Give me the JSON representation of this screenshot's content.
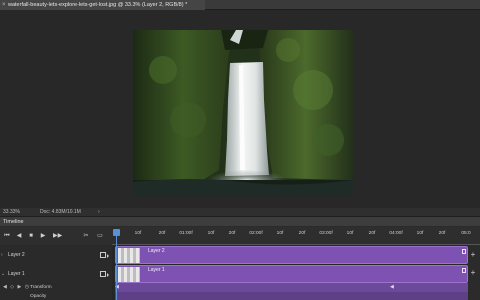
{
  "document": {
    "tab_title": "waterfall-beauty-lets-explore-lets-get-lost.jpg @ 33.3% (Layer 2, RGB/8) *",
    "close_glyph": "×"
  },
  "status": {
    "zoom": "33.33%",
    "doc_size": "Doc: 4.83M/10.1M",
    "arrow": "›"
  },
  "timeline": {
    "title": "Timeline",
    "controls": [
      "⏮",
      "◀",
      "■",
      "▶",
      "▶▶",
      "✂",
      "▭"
    ],
    "ruler_ticks": [
      "10f",
      "20f",
      "01:00f",
      "10f",
      "20f",
      "02:00f",
      "10f",
      "20f",
      "03:00f",
      "10f",
      "20f",
      "04:00f",
      "10f",
      "20f",
      "05:0"
    ],
    "layers": [
      {
        "name": "Layer 2",
        "chevron": "›"
      },
      {
        "name": "Layer 1",
        "chevron": "⌄"
      }
    ],
    "sub_rows": [
      {
        "icons": "◀ ◇ ▶ ◷",
        "label": "Transform"
      },
      {
        "icons": "",
        "label": "Opacity"
      }
    ],
    "clips": [
      {
        "name": "Layer 2"
      },
      {
        "name": "Layer 1"
      }
    ],
    "plus_glyph": "+",
    "keyframe_glyph": "◀"
  },
  "colors": {
    "clip": "#7e52b3",
    "playhead": "#5b8fd6"
  }
}
